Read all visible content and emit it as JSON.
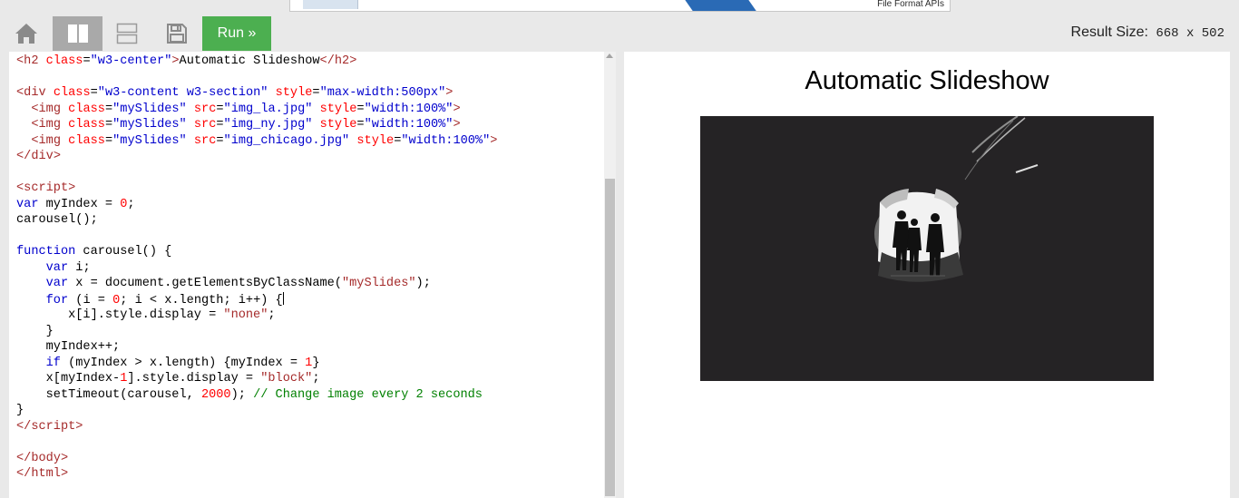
{
  "ad": {
    "text": "File Format APIs"
  },
  "toolbar": {
    "home_icon": "home-icon",
    "horizontal_icon": "two-columns-icon",
    "vertical_icon": "two-rows-icon",
    "save_icon": "floppy-disk-icon",
    "run_label": "Run »",
    "run_color": "#4caf50",
    "result_size_label": "Result Size:",
    "result_size_value": "668 x 502"
  },
  "code": {
    "lines": [
      [
        [
          "tag",
          "<"
        ],
        [
          "tagname",
          "h2"
        ],
        [
          "plain",
          " "
        ],
        [
          "attr",
          "class"
        ],
        [
          "plain",
          "="
        ],
        [
          "str",
          "\"w3-center\""
        ],
        [
          "tag",
          ">"
        ],
        [
          "plain",
          "Automatic Slideshow"
        ],
        [
          "tag",
          "</"
        ],
        [
          "tagname",
          "h2"
        ],
        [
          "tag",
          ">"
        ]
      ],
      [],
      [
        [
          "tag",
          "<"
        ],
        [
          "tagname",
          "div"
        ],
        [
          "plain",
          " "
        ],
        [
          "attr",
          "class"
        ],
        [
          "plain",
          "="
        ],
        [
          "str",
          "\"w3-content w3-section\""
        ],
        [
          "plain",
          " "
        ],
        [
          "attr",
          "style"
        ],
        [
          "plain",
          "="
        ],
        [
          "str",
          "\"max-width:500px\""
        ],
        [
          "tag",
          ">"
        ]
      ],
      [
        [
          "plain",
          "  "
        ],
        [
          "tag",
          "<"
        ],
        [
          "tagname",
          "img"
        ],
        [
          "plain",
          " "
        ],
        [
          "attr",
          "class"
        ],
        [
          "plain",
          "="
        ],
        [
          "str",
          "\"mySlides\""
        ],
        [
          "plain",
          " "
        ],
        [
          "attr",
          "src"
        ],
        [
          "plain",
          "="
        ],
        [
          "str",
          "\"img_la.jpg\""
        ],
        [
          "plain",
          " "
        ],
        [
          "attr",
          "style"
        ],
        [
          "plain",
          "="
        ],
        [
          "str",
          "\"width:100%\""
        ],
        [
          "tag",
          ">"
        ]
      ],
      [
        [
          "plain",
          "  "
        ],
        [
          "tag",
          "<"
        ],
        [
          "tagname",
          "img"
        ],
        [
          "plain",
          " "
        ],
        [
          "attr",
          "class"
        ],
        [
          "plain",
          "="
        ],
        [
          "str",
          "\"mySlides\""
        ],
        [
          "plain",
          " "
        ],
        [
          "attr",
          "src"
        ],
        [
          "plain",
          "="
        ],
        [
          "str",
          "\"img_ny.jpg\""
        ],
        [
          "plain",
          " "
        ],
        [
          "attr",
          "style"
        ],
        [
          "plain",
          "="
        ],
        [
          "str",
          "\"width:100%\""
        ],
        [
          "tag",
          ">"
        ]
      ],
      [
        [
          "plain",
          "  "
        ],
        [
          "tag",
          "<"
        ],
        [
          "tagname",
          "img"
        ],
        [
          "plain",
          " "
        ],
        [
          "attr",
          "class"
        ],
        [
          "plain",
          "="
        ],
        [
          "str",
          "\"mySlides\""
        ],
        [
          "plain",
          " "
        ],
        [
          "attr",
          "src"
        ],
        [
          "plain",
          "="
        ],
        [
          "str",
          "\"img_chicago.jpg\""
        ],
        [
          "plain",
          " "
        ],
        [
          "attr",
          "style"
        ],
        [
          "plain",
          "="
        ],
        [
          "str",
          "\"width:100%\""
        ],
        [
          "tag",
          ">"
        ]
      ],
      [
        [
          "tag",
          "</"
        ],
        [
          "tagname",
          "div"
        ],
        [
          "tag",
          ">"
        ]
      ],
      [],
      [
        [
          "tag",
          "<"
        ],
        [
          "tagname",
          "script"
        ],
        [
          "tag",
          ">"
        ]
      ],
      [
        [
          "kw",
          "var"
        ],
        [
          "plain",
          " myIndex = "
        ],
        [
          "num",
          "0"
        ],
        [
          "plain",
          ";"
        ]
      ],
      [
        [
          "plain",
          "carousel();"
        ]
      ],
      [],
      [
        [
          "kw",
          "function"
        ],
        [
          "plain",
          " carousel() {"
        ]
      ],
      [
        [
          "plain",
          "    "
        ],
        [
          "kw",
          "var"
        ],
        [
          "plain",
          " i;"
        ]
      ],
      [
        [
          "plain",
          "    "
        ],
        [
          "kw",
          "var"
        ],
        [
          "plain",
          " x = document.getElementsByClassName("
        ],
        [
          "jsstr",
          "\"mySlides\""
        ],
        [
          "plain",
          ");"
        ]
      ],
      [
        [
          "plain",
          "    "
        ],
        [
          "kw",
          "for"
        ],
        [
          "plain",
          " (i = "
        ],
        [
          "num",
          "0"
        ],
        [
          "plain",
          "; i < x.length; i++) {"
        ],
        [
          "cursor",
          ""
        ]
      ],
      [
        [
          "plain",
          "       x[i].style.display = "
        ],
        [
          "jsstr",
          "\"none\""
        ],
        [
          "plain",
          ";"
        ]
      ],
      [
        [
          "plain",
          "    }"
        ]
      ],
      [
        [
          "plain",
          "    myIndex++;"
        ]
      ],
      [
        [
          "plain",
          "    "
        ],
        [
          "kw",
          "if"
        ],
        [
          "plain",
          " (myIndex > x.length) {myIndex = "
        ],
        [
          "num",
          "1"
        ],
        [
          "plain",
          "}"
        ]
      ],
      [
        [
          "plain",
          "    x[myIndex-"
        ],
        [
          "num",
          "1"
        ],
        [
          "plain",
          "].style.display = "
        ],
        [
          "jsstr",
          "\"block\""
        ],
        [
          "plain",
          ";"
        ]
      ],
      [
        [
          "plain",
          "    setTimeout(carousel, "
        ],
        [
          "num",
          "2000"
        ],
        [
          "plain",
          "); "
        ],
        [
          "comment",
          "// Change image every 2 seconds"
        ]
      ],
      [
        [
          "plain",
          "}"
        ]
      ],
      [
        [
          "tag",
          "</"
        ],
        [
          "tagname",
          "script"
        ],
        [
          "tag",
          ">"
        ]
      ],
      [],
      [
        [
          "tag",
          "</"
        ],
        [
          "tagname",
          "body"
        ],
        [
          "tag",
          ">"
        ]
      ],
      [
        [
          "tag",
          "</"
        ],
        [
          "tagname",
          "html"
        ],
        [
          "tag",
          ">"
        ]
      ]
    ]
  },
  "result": {
    "title": "Automatic Slideshow",
    "image_subject": "tunnel-silhouettes-image"
  },
  "colors": {
    "background": "#e9e9e9",
    "run_button": "#4caf50",
    "active_toggle": "#a9a9a9"
  }
}
